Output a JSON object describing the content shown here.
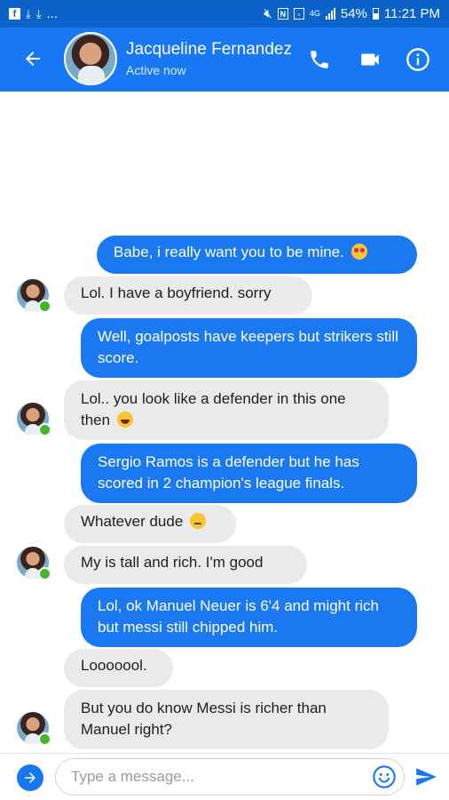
{
  "status_bar": {
    "network": "4G",
    "battery": "54%",
    "time": "11:21 PM",
    "more": "..."
  },
  "header": {
    "contact_name": "Jacqueline Fernandez",
    "status": "Active now"
  },
  "messages": [
    {
      "from": "me",
      "text": "Babe, i really want you to be mine.",
      "emoji": "heart-eyes"
    },
    {
      "from": "contact",
      "text": "Lol. I have a boyfriend. sorry"
    },
    {
      "from": "me",
      "text": "Well, goalposts have keepers but strikers still score."
    },
    {
      "from": "contact",
      "text": "Lol.. you look like a defender in this one then",
      "emoji": "rolling-laughing"
    },
    {
      "from": "me",
      "text": "Sergio Ramos is a defender but he has scored in 2 champion's league finals."
    },
    {
      "from": "contact",
      "text": "Whatever dude",
      "emoji": "smirk"
    },
    {
      "from": "contact",
      "text": "My is tall and rich. I'm good"
    },
    {
      "from": "me",
      "text": "Lol, ok Manuel Neuer is 6'4 and might rich but messi still chipped him."
    },
    {
      "from": "contact",
      "text": "Looooool."
    },
    {
      "from": "contact",
      "text": "But you do know Messi is richer than Manuel right?"
    }
  ],
  "composer": {
    "placeholder": "Type a message..."
  },
  "colors": {
    "status_bar": "#0b63c9",
    "header": "#1877f2",
    "outgoing_bubble": "#1a79f0",
    "incoming_bubble": "#eaeaea",
    "online_dot": "#42b72a"
  }
}
